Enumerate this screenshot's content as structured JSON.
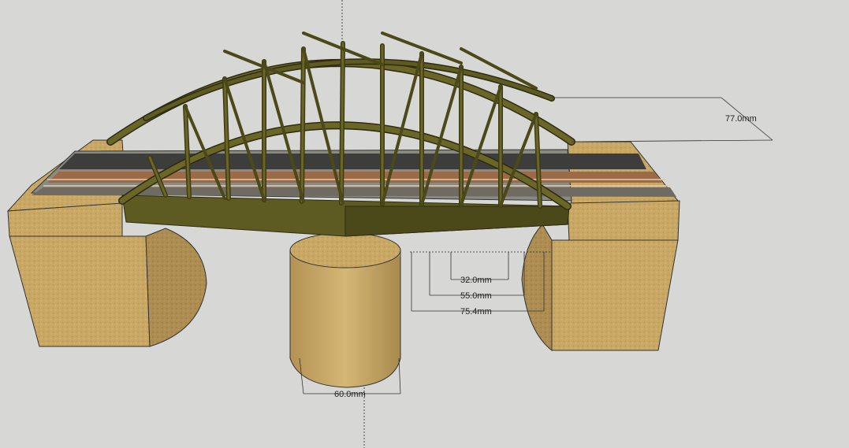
{
  "viewport": {
    "background": "#d7d7d5",
    "axis_color": "#555555"
  },
  "model": {
    "truss_color": "#5e5b22",
    "truss_dark": "#3d3b14",
    "stone_color": "#c9a865",
    "stone_shade": "#a8894e",
    "deck_color": "#4a4a48"
  },
  "dimensions": {
    "height": "77.0mm",
    "inner_1": "32.0mm",
    "inner_2": "55.0mm",
    "inner_3": "75.4mm",
    "pier_width": "60.0mm"
  }
}
